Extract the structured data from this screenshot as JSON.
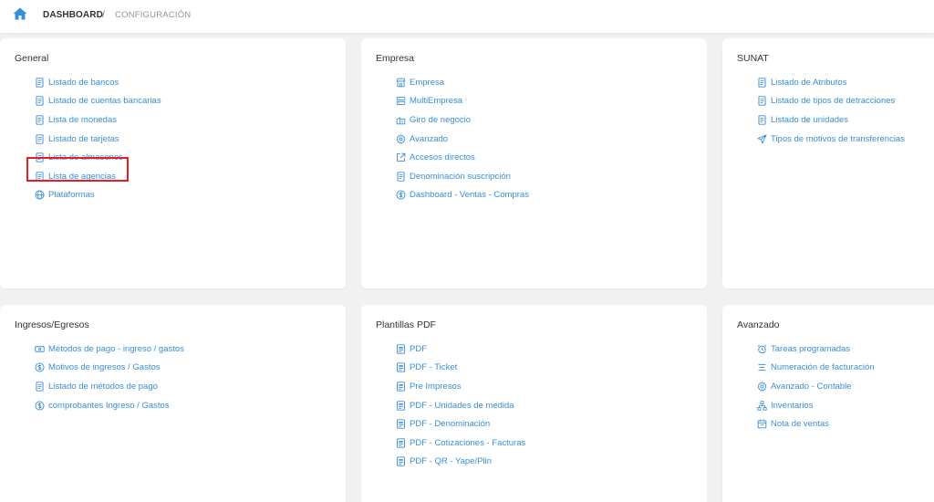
{
  "breadcrumb": {
    "home_icon": "home-icon",
    "dashboard": "DASHBOARD",
    "separator": "/",
    "current": "CONFIGURACIÓN"
  },
  "accent_color": "#3a8ed5",
  "highlight_color": "#e21e2a",
  "cards": [
    {
      "title": "General",
      "items": [
        {
          "label": "Listado de bancos",
          "icon": "document-icon"
        },
        {
          "label": "Listado de cuentas bancarias",
          "icon": "document-icon"
        },
        {
          "label": "Lista de monedas",
          "icon": "document-icon"
        },
        {
          "label": "Listado de tarjetas",
          "icon": "document-icon"
        },
        {
          "label": "Lista de almacenes",
          "icon": "document-icon"
        },
        {
          "label": "Lista de agencias",
          "icon": "document-icon"
        },
        {
          "label": "Plataformas",
          "icon": "globe-icon"
        }
      ]
    },
    {
      "title": "Empresa",
      "items": [
        {
          "label": "Empresa",
          "icon": "store-icon"
        },
        {
          "label": "MultiEmpresa",
          "icon": "server-icon"
        },
        {
          "label": "Giro de negocio",
          "icon": "building-icon"
        },
        {
          "label": "Avanzado",
          "icon": "gear-icon"
        },
        {
          "label": "Accesos directos",
          "icon": "external-link-icon"
        },
        {
          "label": "Denominación suscripción",
          "icon": "document-icon"
        },
        {
          "label": "Dashboard - Ventas - Compras",
          "icon": "dollar-circle-icon"
        }
      ]
    },
    {
      "title": "SUNAT",
      "items": [
        {
          "label": "Listado de Atributos",
          "icon": "document-icon"
        },
        {
          "label": "Listado de tipos de detracciones",
          "icon": "document-icon"
        },
        {
          "label": "Listado de unidades",
          "icon": "document-icon"
        },
        {
          "label": "Tipos de motivos de transferencias",
          "icon": "send-icon"
        }
      ]
    },
    {
      "title": "Ingresos/Egresos",
      "items": [
        {
          "label": "Métodos de pago - ingreso / gastos",
          "icon": "cash-icon"
        },
        {
          "label": "Motivos de ingresos / Gastos",
          "icon": "dollar-circle-icon"
        },
        {
          "label": "Listado de métodos de pago",
          "icon": "document-icon"
        },
        {
          "label": "comprobantes Ingreso / Gastos",
          "icon": "dollar-circle-icon"
        }
      ]
    },
    {
      "title": "Plantillas PDF",
      "items": [
        {
          "label": "PDF",
          "icon": "pdf-file-icon"
        },
        {
          "label": "PDF - Ticket",
          "icon": "pdf-file-icon"
        },
        {
          "label": "Pre Impresos",
          "icon": "pdf-file-icon"
        },
        {
          "label": "PDF - Unidades de medida",
          "icon": "pdf-file-icon"
        },
        {
          "label": "PDF - Denominación",
          "icon": "pdf-file-icon"
        },
        {
          "label": "PDF - Cotizaciones - Facturas",
          "icon": "pdf-file-icon"
        },
        {
          "label": "PDF - QR - Yape/Plin",
          "icon": "pdf-file-icon"
        }
      ]
    },
    {
      "title": "Avanzado",
      "items": [
        {
          "label": "Tareas programadas",
          "icon": "alarm-clock-icon"
        },
        {
          "label": "Numeración de facturación",
          "icon": "list-icon"
        },
        {
          "label": "Avanzado - Contable",
          "icon": "gear-icon"
        },
        {
          "label": "Inventarios",
          "icon": "hierarchy-icon"
        },
        {
          "label": "Nota de ventas",
          "icon": "calendar-icon"
        }
      ]
    }
  ],
  "highlighted_item": "Lista de agencias"
}
